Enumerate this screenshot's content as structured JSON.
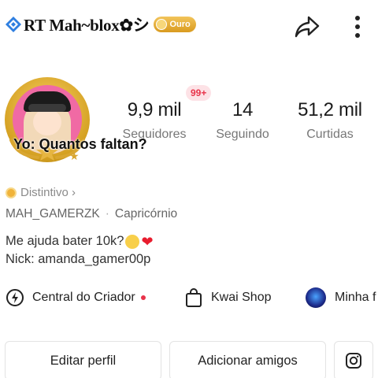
{
  "header": {
    "title": "RT Mah~blox✿シ",
    "rank_badge": "Ouro",
    "share_icon": "share-arrow-icon",
    "more_icon": "more-vertical-icon"
  },
  "profile": {
    "notification_badge": "99+",
    "stats": [
      {
        "value": "9,9 mil",
        "label": "Seguidores"
      },
      {
        "value": "14",
        "label": "Seguindo"
      },
      {
        "value": "51,2 mil",
        "label": "Curtidas"
      }
    ],
    "overlay_caption": "Yo: Quantos faltan?",
    "badge_link": "Distintivo ›",
    "username": "MAH_GAMERZK",
    "separator": "·",
    "sign": "Capricórnio",
    "bio_line1": "Me ajuda bater 10k?",
    "bio_line2": "Nick: amanda_gamer00p"
  },
  "links": [
    {
      "label": "Central do Criador",
      "icon": "creator-center-icon"
    },
    {
      "label": "Kwai Shop",
      "icon": "shopping-bag-icon"
    },
    {
      "label": "Minha f",
      "icon": "avatar-thumbnail"
    }
  ],
  "actions": {
    "edit": "Editar perfil",
    "add_friends": "Adicionar amigos",
    "instagram_icon": "instagram-icon"
  },
  "colors": {
    "accent_red": "#e8334a",
    "gold": "#d9a630",
    "avatar_bg": "#f06aa4"
  }
}
